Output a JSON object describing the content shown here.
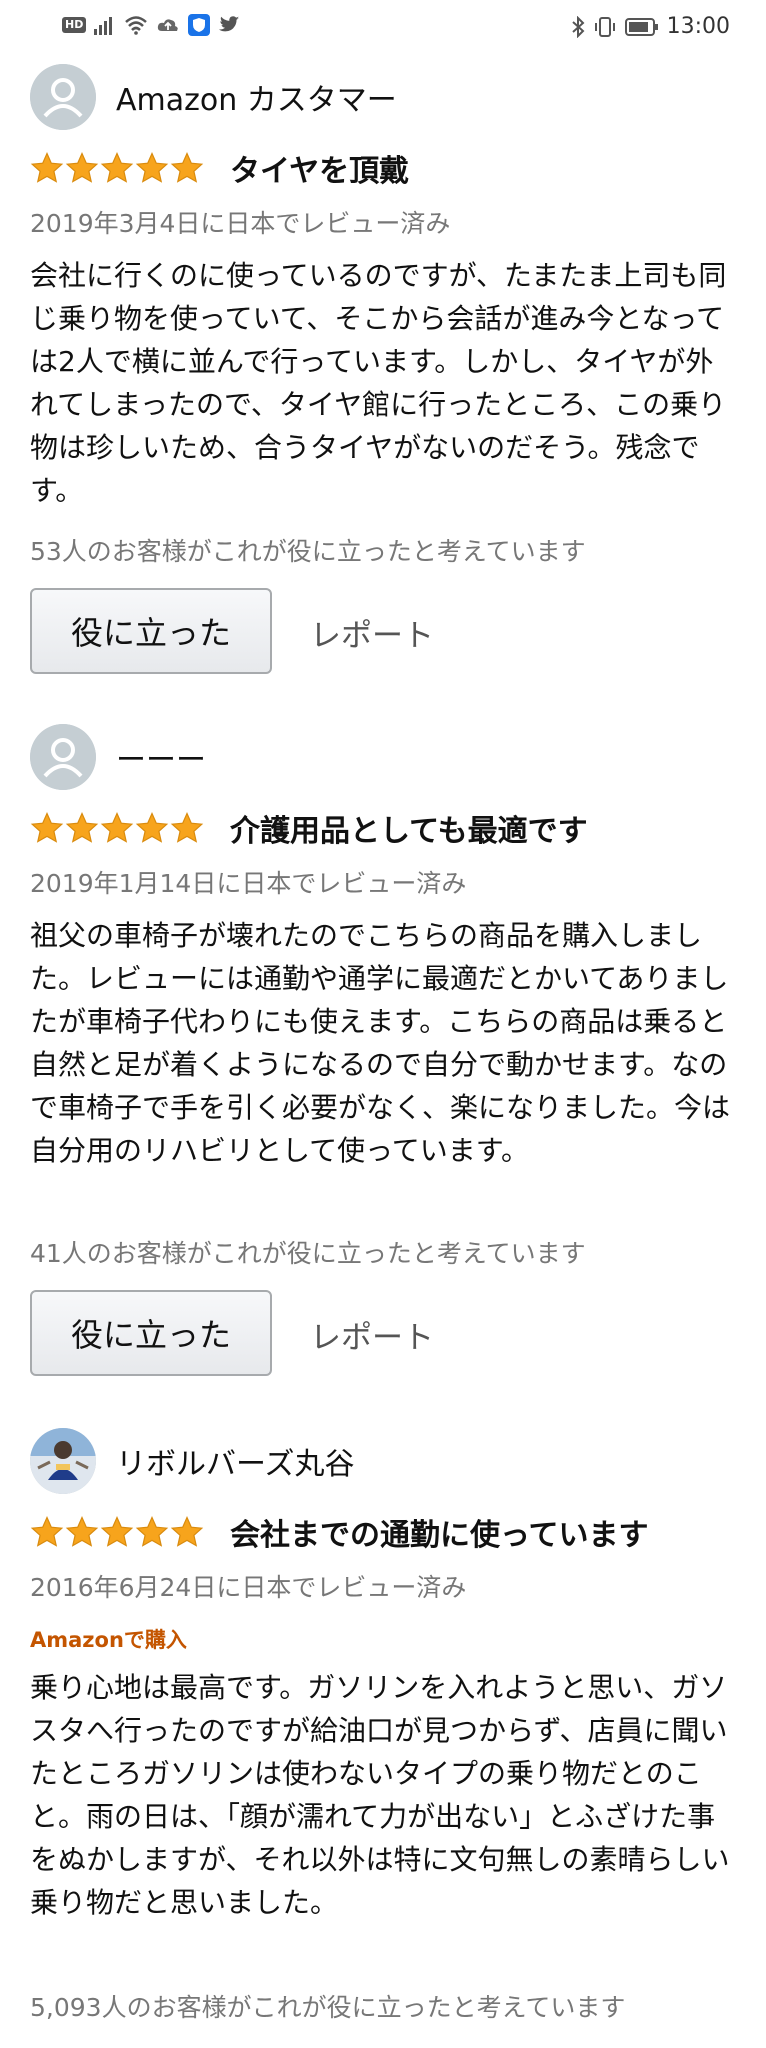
{
  "status_bar": {
    "hd": "HD",
    "time": "13:00"
  },
  "reviews": [
    {
      "reviewer": "Amazon カスタマー",
      "stars": 5,
      "title": "タイヤを頂戴",
      "date": "2019年3月4日に日本でレビュー済み",
      "body": "会社に行くのに使っているのですが、たまたま上司も同じ乗り物を使っていて、そこから会話が進み今となっては2人で横に並んで行っています。しかし、タイヤが外れてしまったので、タイヤ館に行ったところ、この乗り物は珍しいため、合うタイヤがないのだそう。残念です。",
      "helpful": "53人のお客様がこれが役に立ったと考えています",
      "helpful_button": "役に立った",
      "report": "レポート"
    },
    {
      "reviewer": "ーーー",
      "stars": 5,
      "title": "介護用品としても最適です",
      "date": "2019年1月14日に日本でレビュー済み",
      "body": "祖父の車椅子が壊れたのでこちらの商品を購入しました。レビューには通勤や通学に最適だとかいてありましたが車椅子代わりにも使えます。こちらの商品は乗ると自然と足が着くようになるので自分で動かせます。なので車椅子で手を引く必要がなく、楽になりました。今は自分用のリハビリとして使っています。",
      "helpful": "41人のお客様がこれが役に立ったと考えています",
      "helpful_button": "役に立った",
      "report": "レポート"
    },
    {
      "reviewer": "リボルバーズ丸谷",
      "stars": 5,
      "title": "会社までの通勤に使っています",
      "date": "2016年6月24日に日本でレビュー済み",
      "badge": "Amazonで購入",
      "body": "乗り心地は最高です。ガソリンを入れようと思い、ガソスタへ行ったのですが給油口が見つからず、店員に聞いたところガソリンは使わないタイプの乗り物だとのこと。雨の日は、「顔が濡れて力が出ない」とふざけた事をぬかしますが、それ以外は特に文句無しの素晴らしい乗り物だと思いました。",
      "helpful": "5,093人のお客様がこれが役に立ったと考えています"
    }
  ],
  "colors": {
    "star": "#f7a41c",
    "badge": "#c45500",
    "meta": "#777777"
  }
}
